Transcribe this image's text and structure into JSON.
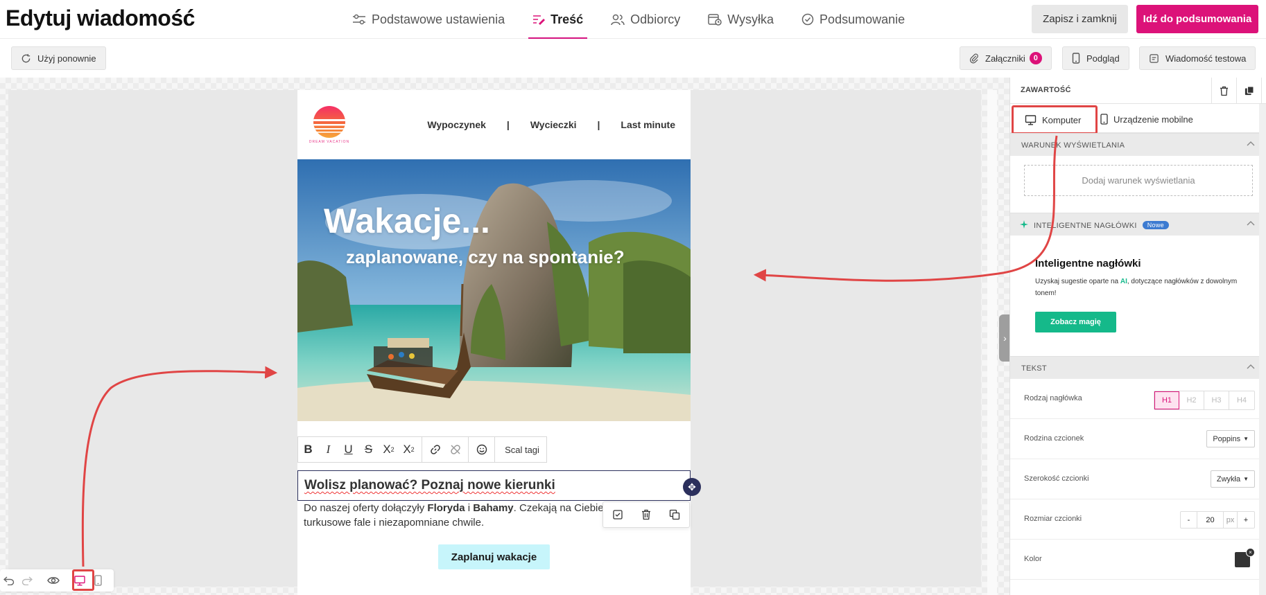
{
  "header": {
    "title": "Edytuj wiadomość",
    "steps": [
      {
        "label": "Podstawowe ustawienia",
        "icon": "sliders-icon"
      },
      {
        "label": "Treść",
        "icon": "edit-lines-icon",
        "active": true
      },
      {
        "label": "Odbiorcy",
        "icon": "users-icon"
      },
      {
        "label": "Wysyłka",
        "icon": "calendar-clock-icon"
      },
      {
        "label": "Podsumowanie",
        "icon": "check-circle-icon"
      }
    ],
    "save_label": "Zapisz i zamknij",
    "summary_label": "Idź do podsumowania"
  },
  "toolbar": {
    "reuse_label": "Użyj ponownie",
    "attachments_label": "Załączniki",
    "attachments_count": "0",
    "preview_label": "Podgląd",
    "test_label": "Wiadomość testowa"
  },
  "email": {
    "logo_text": "DREAM VACATION",
    "nav": [
      "Wypoczynek",
      "Wycieczki",
      "Last minute"
    ],
    "nav_separator": "|",
    "hero_title": "Wakacje...",
    "hero_subtitle": "zaplanowane, czy na spontanie?",
    "rte_tags_label": "Scal tagi",
    "heading": "Wolisz planować? Poznaj nowe kierunki",
    "body_pre": "Do naszej oferty dołączyły ",
    "body_b1": "Floryda",
    "body_mid": " i ",
    "body_b2": "Bahamy",
    "body_post": ". Czekają na Ciebie z",
    "body_line2": "turkusowe fale i niezapomniane chwile.",
    "cta": "Zaplanuj wakacje"
  },
  "panel": {
    "header": "ZAWARTOŚĆ",
    "tab_desktop": "Komputer",
    "tab_mobile": "Urządzenie mobilne",
    "display_condition": {
      "title": "WARUNEK WYŚWIETLANIA",
      "add_label": "Dodaj warunek wyświetlania"
    },
    "smart_headers": {
      "title": "INTELIGENTNE NAGŁÓWKI",
      "badge": "Nowe",
      "card_title": "Inteligentne nagłówki",
      "desc_pre": "Uzyskaj sugestie oparte na ",
      "desc_ai": "AI",
      "desc_post": ", dotyczące nagłówków z dowolnym tonem!",
      "button": "Zobacz magię"
    },
    "text": {
      "title": "TEKST",
      "heading_type_label": "Rodzaj nagłówka",
      "heading_options": [
        "H1",
        "H2",
        "H3",
        "H4"
      ],
      "font_family_label": "Rodzina czcionek",
      "font_family_value": "Poppins",
      "font_weight_label": "Szerokość czcionki",
      "font_weight_value": "Zwykła",
      "font_size_label": "Rozmiar czcionki",
      "font_size_minus": "-",
      "font_size_value": "20",
      "font_size_unit": "px",
      "font_size_plus": "+",
      "color_label": "Kolor",
      "color_value": "#333333"
    }
  },
  "colors": {
    "accent": "#dc1279",
    "cta_bg": "#c7f5fb",
    "ai_green": "#15b98a",
    "annotation": "#e04545"
  }
}
